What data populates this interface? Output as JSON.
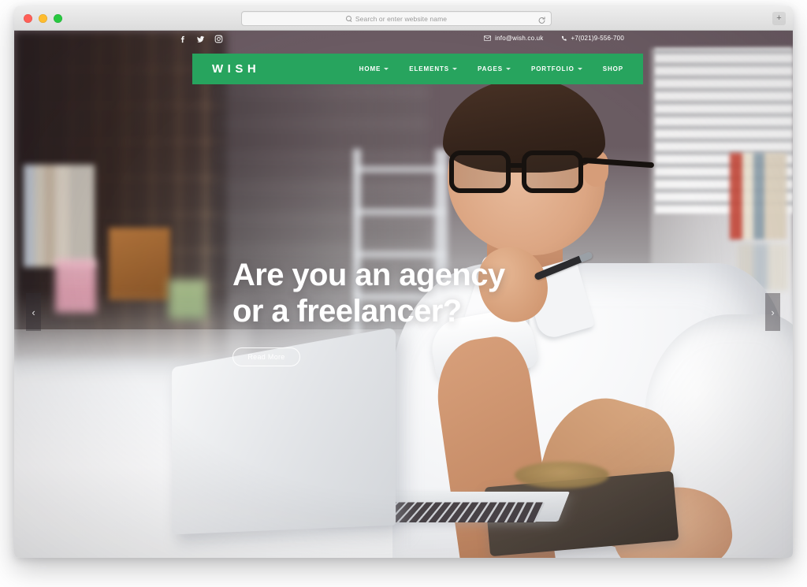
{
  "browser": {
    "traffic_lights": [
      "close",
      "minimize",
      "zoom"
    ],
    "address_placeholder": "Search or enter website name",
    "search_icon": "search-icon",
    "reload_icon": "reload-icon",
    "extra_button_label": "+"
  },
  "site": {
    "topbar": {
      "social": [
        {
          "name": "facebook-icon",
          "glyph": "f"
        },
        {
          "name": "twitter-icon",
          "glyph": "✉"
        },
        {
          "name": "instagram-icon",
          "glyph": "▣"
        }
      ],
      "email": "info@wish.co.uk",
      "phone": "+7(021)9-556-700",
      "email_icon": "envelope-icon",
      "phone_icon": "phone-icon"
    },
    "brand": "WISH",
    "menu": [
      {
        "label": "HOME",
        "has_caret": true
      },
      {
        "label": "ELEMENTS",
        "has_caret": true
      },
      {
        "label": "PAGES",
        "has_caret": true
      },
      {
        "label": "PORTFOLIO",
        "has_caret": true
      },
      {
        "label": "SHOP",
        "has_caret": false
      }
    ],
    "hero": {
      "title": "Are you an agency\nor a freelancer?",
      "button_label": "Read More",
      "prev_label": "‹",
      "next_label": "›"
    },
    "colors": {
      "brand_green": "#27a45e",
      "text_white": "#ffffff"
    }
  }
}
